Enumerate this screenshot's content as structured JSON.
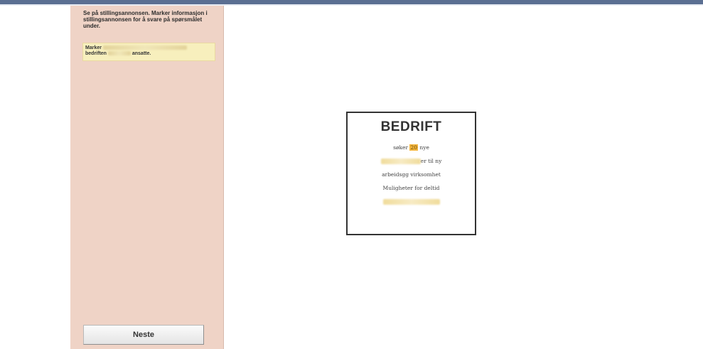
{
  "sidebar": {
    "instruction": "Se på stillingsannonsen. Marker informasjon i stillingsannonsen for å svare på spørsmålet under.",
    "task": {
      "prefix": "Marker",
      "line2_start": "bedriften",
      "line2_end": "ansatte."
    },
    "next_label": "Neste"
  },
  "ad": {
    "title": "BEDRIFT",
    "line1_pre": "søker",
    "line1_highlight": "20",
    "line1_post": "nye",
    "line2_post": "er til ny",
    "line3": "arbeidsgg virksomhet",
    "line4": "Muligheter for deltid"
  },
  "colors": {
    "sidebar_bg": "#efd3c6",
    "task_bg": "#f7efbd",
    "highlight_orange": "#f4b63f",
    "topbar": "#5b6f92"
  }
}
